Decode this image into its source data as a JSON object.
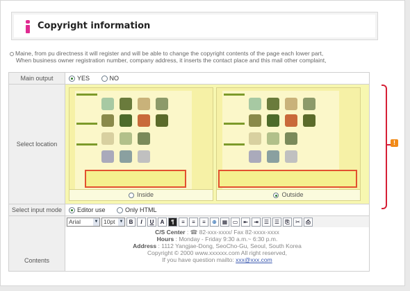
{
  "header": {
    "title": "Copyright information",
    "accent_color": "#e02b91"
  },
  "description": {
    "line1": "Maine, from pu directness it will register and will be able to change the copyright contents of the page each lower part,",
    "line2": "When business owner registration number, company address, it inserts the contact place and this mail other complaint,"
  },
  "form": {
    "main_output": {
      "label": "Main output",
      "options": [
        "YES",
        "NO"
      ],
      "selected": "YES"
    },
    "select_location": {
      "label": "Select location",
      "options": [
        {
          "label": "Inside",
          "selected": false
        },
        {
          "label": "Outside",
          "selected": true
        }
      ],
      "highlight_color": "#e2512f"
    },
    "input_mode": {
      "label": "Select input mode",
      "options": [
        "Editor use",
        "Only HTML"
      ],
      "selected": "Editor use"
    },
    "contents": {
      "label": "Contents",
      "toolbar": {
        "font": "Arial",
        "size": "10pt",
        "buttons": [
          "B",
          "I",
          "U",
          "A",
          "¶",
          "≡",
          "≡",
          "≡",
          "⊕",
          "▦",
          "▭",
          "⇤",
          "⇥",
          "☰",
          "☰",
          "⎘",
          "✂",
          "⎙"
        ]
      },
      "text": {
        "cs_label": "C/S Center",
        "cs_value": ": ☎ 82-xxx-xxxx/ Fax 82-xxxx-xxxx",
        "hours_label": "Hours",
        "hours_value": ": Monday - Friday 9:30 a.m.~ 6:30 p.m.",
        "address_label": "Address",
        "address_value": ": 1112 Yangjae-Dong, SeoCho-Gu, Seoul, South Korea",
        "copyright": "Copyright © 2000 www.xxxxxx.com All right reserved,",
        "question_prefix": "If you have question mailto:",
        "email": "xxx@xxx.com"
      }
    }
  },
  "annotation": {
    "icon": "warning-icon",
    "icon_text": "!",
    "color": "#d61f35"
  }
}
